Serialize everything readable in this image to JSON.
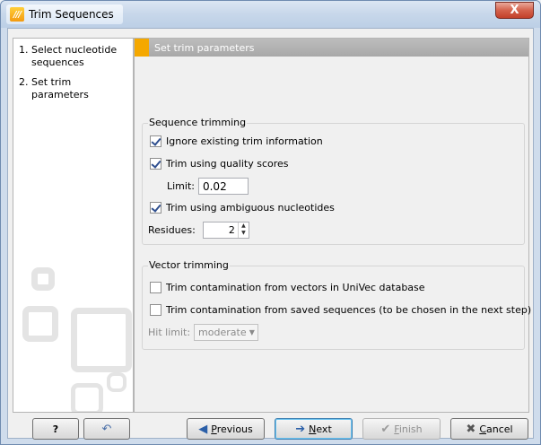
{
  "window": {
    "title": "Trim Sequences",
    "close_glyph": "X"
  },
  "steps": [
    {
      "num": "1.",
      "label": "Select nucleotide sequences"
    },
    {
      "num": "2.",
      "label": "Set trim parameters"
    }
  ],
  "panel": {
    "header": "Set trim parameters"
  },
  "sequence_trimming": {
    "title": "Sequence trimming",
    "ignore_existing": {
      "label": "Ignore existing trim information",
      "checked": true
    },
    "quality_scores": {
      "label": "Trim using quality scores",
      "checked": true
    },
    "limit": {
      "label": "Limit:",
      "value": "0.02"
    },
    "ambiguous": {
      "label": "Trim using ambiguous nucleotides",
      "checked": true
    },
    "residues": {
      "label": "Residues:",
      "value": "2"
    }
  },
  "vector_trimming": {
    "title": "Vector trimming",
    "univec": {
      "label": "Trim contamination from vectors in UniVec database",
      "checked": false
    },
    "saved": {
      "label": "Trim contamination from saved sequences (to be chosen in the next step)",
      "checked": false
    },
    "hit_limit": {
      "label": "Hit limit:",
      "value": "moderate"
    }
  },
  "buttons": {
    "help": "?",
    "previous_prefix": "",
    "previous_accel": "P",
    "previous_rest": "revious",
    "next_accel": "N",
    "next_rest": "ext",
    "finish_accel": "F",
    "finish_rest": "inish",
    "cancel_accel": "C",
    "cancel_rest": "ancel"
  },
  "colors": {
    "accent": "#f5a800",
    "header_bg": "#b2b2b2",
    "close_red": "#c2402a"
  }
}
